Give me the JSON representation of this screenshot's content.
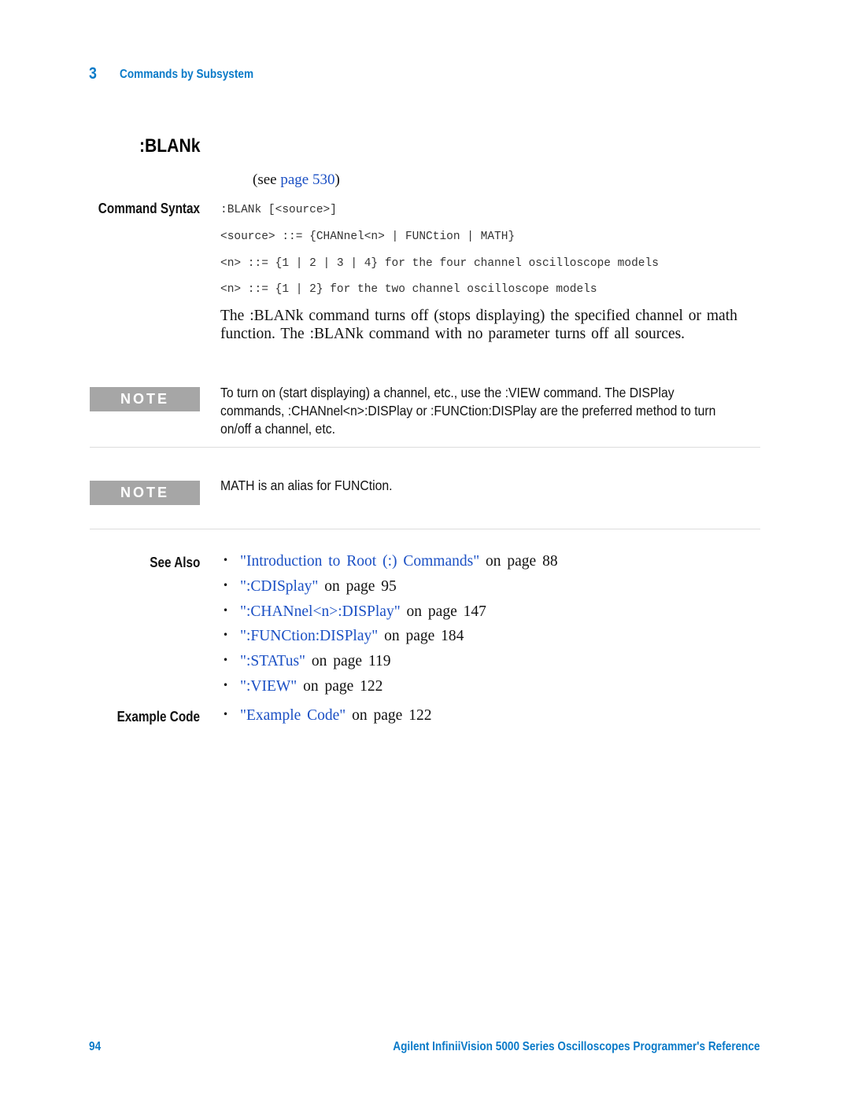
{
  "header": {
    "chapter_number": "3",
    "chapter_title": "Commands by Subsystem"
  },
  "section": {
    "title": ":BLANk",
    "see_prefix": "(see",
    "see_link": "page 530",
    "see_suffix": ")"
  },
  "command_syntax": {
    "label": "Command Syntax",
    "lines": [
      ":BLANk [<source>]",
      "<source> ::= {CHANnel<n> | FUNCtion | MATH}",
      "<n> ::= {1 | 2 | 3 | 4} for the four channel oscilloscope models",
      "<n> ::= {1 | 2} for the two channel oscilloscope models"
    ],
    "description": "The :BLANk command turns off (stops displaying) the specified channel or math function. The :BLANk command with no parameter turns off all sources."
  },
  "notes": [
    {
      "label": "NOTE",
      "text": "To turn on (start displaying) a channel, etc., use the :VIEW command. The DISPlay commands, :CHANnel<n>:DISPlay or :FUNCtion:DISPlay are the preferred method to turn on/off a channel, etc."
    },
    {
      "label": "NOTE",
      "text": "MATH is an alias for FUNCtion."
    }
  ],
  "see_also": {
    "label": "See Also",
    "items": [
      {
        "link": "\"Introduction to Root (:) Commands\"",
        "suffix": " on page 88"
      },
      {
        "link": "\":CDISplay\"",
        "suffix": " on page 95"
      },
      {
        "link": "\":CHANnel<n>:DISPlay\"",
        "suffix": " on page 147"
      },
      {
        "link": "\":FUNCtion:DISPlay\"",
        "suffix": " on page 184"
      },
      {
        "link": "\":STATus\"",
        "suffix": " on page 119"
      },
      {
        "link": "\":VIEW\"",
        "suffix": " on page 122"
      }
    ]
  },
  "example_code": {
    "label": "Example Code",
    "items": [
      {
        "link": "\"Example Code\"",
        "suffix": " on page 122"
      }
    ]
  },
  "bullet_glyph": "•",
  "footer": {
    "page_number": "94",
    "book_title": "Agilent InfiniiVision 5000 Series Oscilloscopes Programmer's Reference"
  },
  "colors": {
    "accent_blue": "#0a7ac8",
    "link_blue": "#1a4fc4",
    "note_gray": "#a6a6a6"
  }
}
